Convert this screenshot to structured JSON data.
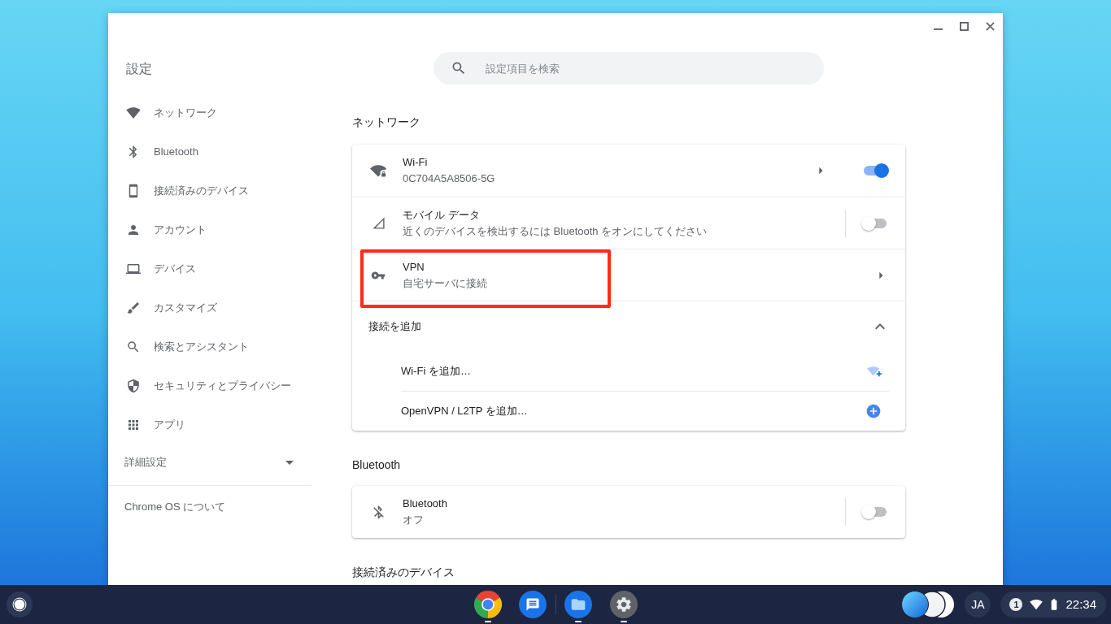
{
  "window": {
    "title": "設定"
  },
  "sidebar": {
    "items": [
      {
        "label": "ネットワーク"
      },
      {
        "label": "Bluetooth"
      },
      {
        "label": "接続済みのデバイス"
      },
      {
        "label": "アカウント"
      },
      {
        "label": "デバイス"
      },
      {
        "label": "カスタマイズ"
      },
      {
        "label": "検索とアシスタント"
      },
      {
        "label": "セキュリティとプライバシー"
      },
      {
        "label": "アプリ"
      }
    ],
    "advanced": {
      "label": "詳細設定",
      "expanded": false
    },
    "about": {
      "label": "Chrome OS について"
    }
  },
  "search": {
    "placeholder": "設定項目を検索"
  },
  "sections": [
    {
      "title": "ネットワーク",
      "rows": [
        {
          "kind": "detail",
          "title": "Wi-Fi",
          "subtitle": "0C704A5A8506-5G",
          "on": true,
          "highlighted": false
        },
        {
          "kind": "switch",
          "title": "モバイル データ",
          "subtitle": "近くのデバイスを検出するには Bluetooth をオンにしてください",
          "on": false,
          "highlighted": false
        },
        {
          "kind": "link",
          "title": "VPN",
          "subtitle": "自宅サーバに接続",
          "highlighted": true
        }
      ],
      "add_connection": {
        "label": "接続を追加",
        "expanded": true,
        "items": [
          {
            "label": "Wi-Fi を追加…"
          },
          {
            "label": "OpenVPN / L2TP を追加…"
          }
        ]
      }
    },
    {
      "title": "Bluetooth",
      "rows": [
        {
          "kind": "switch",
          "title": "Bluetooth",
          "subtitle": "オフ",
          "on": false,
          "highlighted": false
        }
      ]
    },
    {
      "title": "接続済みのデバイス"
    }
  ],
  "taskbar": {
    "apps": [
      {
        "running": true
      },
      {
        "running": false
      },
      {
        "running": true
      },
      {
        "running": true
      }
    ],
    "ime": "JA",
    "notifications": "1",
    "time": "22:34"
  }
}
